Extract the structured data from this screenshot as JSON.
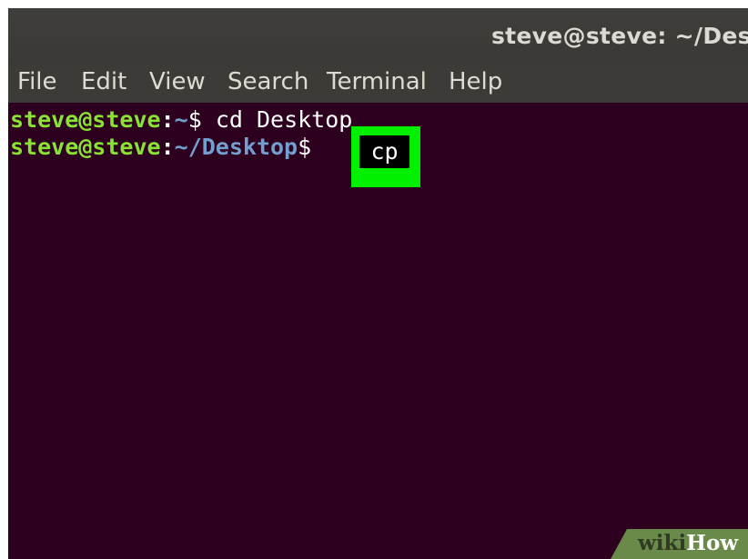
{
  "window": {
    "title": "steve@steve: ~/Desk"
  },
  "menu": {
    "items": [
      "File",
      "Edit",
      "View",
      "Search",
      "Terminal",
      "Help"
    ]
  },
  "terminal": {
    "line1": {
      "user_host": "steve@steve",
      "separator": ":",
      "path": "~",
      "prompt": "$",
      "command": " cd Desktop"
    },
    "line2": {
      "user_host": "steve@steve",
      "separator": ":",
      "path": "~/Desktop",
      "prompt": "$",
      "command": "cp"
    }
  },
  "colors": {
    "terminal_bg": "#2c001e",
    "prompt_user": "#8ae234",
    "prompt_path": "#729fcf",
    "highlight": "#00f000"
  },
  "watermark": {
    "wiki": "wiki",
    "how": "How"
  }
}
